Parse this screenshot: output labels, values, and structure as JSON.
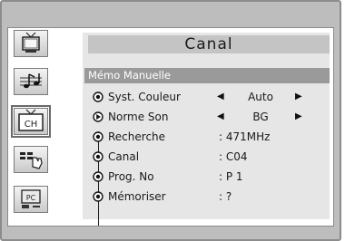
{
  "menu": {
    "title": "Canal",
    "section": "Mémo Manuelle"
  },
  "sidebar": {
    "items": [
      {
        "name": "picture",
        "icon": "tv-picture-icon"
      },
      {
        "name": "sound",
        "icon": "music-note-icon"
      },
      {
        "name": "channel",
        "icon": "channel-ch-icon",
        "label": "CH",
        "active": true
      },
      {
        "name": "setup",
        "icon": "hand-setup-icon"
      },
      {
        "name": "pc",
        "icon": "pc-icon",
        "label": "PC"
      }
    ]
  },
  "rows": [
    {
      "label": "Syst. Couleur",
      "value": "Auto",
      "has_arrows": true
    },
    {
      "label": "Norme Son",
      "value": "BG",
      "has_arrows": true
    },
    {
      "label": "Recherche",
      "value": ": 471MHz"
    },
    {
      "label": "Canal",
      "value": ": C04"
    },
    {
      "label": "Prog. No",
      "value": ": P 1"
    },
    {
      "label": "Mémoriser",
      "value": ": ?"
    }
  ],
  "arrows": {
    "left": "◀",
    "right": "▶"
  }
}
